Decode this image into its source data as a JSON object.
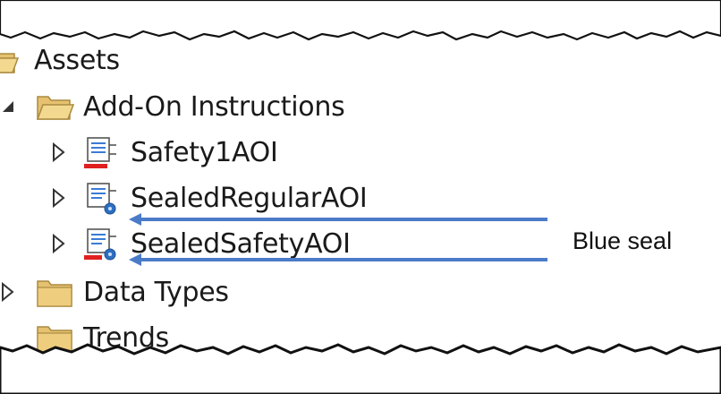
{
  "tree": {
    "items": [
      {
        "label": "Assets",
        "icon": "folder-open-icon",
        "expander": "none"
      },
      {
        "label": "Add-On Instructions",
        "icon": "folder-open-icon",
        "expander": "expanded"
      },
      {
        "label": "Safety1AOI",
        "icon": "safety-aoi-icon",
        "expander": "collapsed"
      },
      {
        "label": "SealedRegularAOI",
        "icon": "sealed-aoi-icon",
        "expander": "collapsed"
      },
      {
        "label": "SealedSafetyAOI",
        "icon": "sealed-safety-aoi-icon",
        "expander": "collapsed"
      },
      {
        "label": "Data Types",
        "icon": "folder-icon",
        "expander": "collapsed"
      },
      {
        "label": "Trends",
        "icon": "folder-icon",
        "expander": "none"
      }
    ]
  },
  "annotation": {
    "text": "Blue seal",
    "arrow_color": "#4a7bc8"
  },
  "colors": {
    "folder": "#e6c170",
    "safety_bar": "#e02020",
    "seal": "#2c6fc4"
  }
}
